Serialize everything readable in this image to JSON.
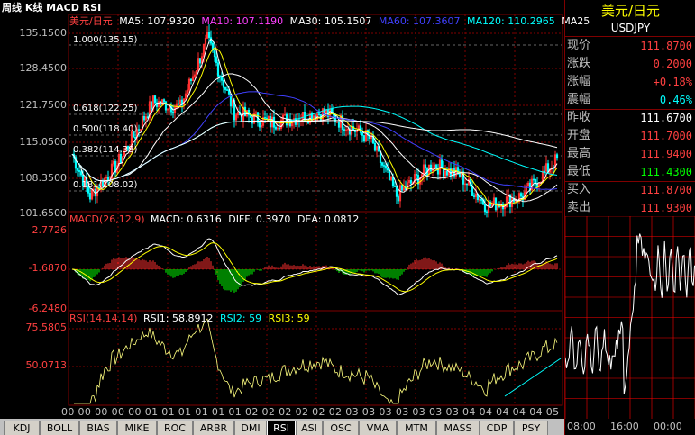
{
  "window_title": "周线 K线 MACD RSI",
  "main_legend": {
    "name": "美元/日元",
    "ma5": "MA5: 107.9320",
    "ma10": "MA10: 107.1190",
    "ma30": "MA30: 105.1507",
    "ma60": "MA60: 107.3607",
    "ma120": "MA120: 110.2965",
    "ma250": "MA25"
  },
  "fib_labels": [
    "1.000(135.15)",
    "0.618(122.25)",
    "0.500(118.40)",
    "0.382(114.38)",
    "0.181(108.02)"
  ],
  "price_axis": [
    "135.1500",
    "128.4500",
    "121.7500",
    "115.0500",
    "108.3500",
    "101.6500"
  ],
  "macd_legend": {
    "name": "MACD(26,12,9)",
    "macd": "MACD: 0.6316",
    "diff": "DIFF: 0.3970",
    "dea": "DEA: 0.0812"
  },
  "macd_axis": [
    "2.7726",
    "-1.6870",
    "-6.2480"
  ],
  "rsi_legend": {
    "name": "RSI(14,14,14)",
    "rsi1": "RSI1: 58.8912",
    "rsi2": "RSI2: 59",
    "rsi3": "RSI3: 59"
  },
  "rsi_axis": [
    "75.5805",
    "50.0713"
  ],
  "time_axis": "00 00 00 00 00 01 01 01 01 01 01 02 02 02 02 02 02 03 03 03 03 03 03 03 04 04 04 04 04 05 05 05 05 05",
  "tabs": [
    "KDJ",
    "BOLL",
    "BIAS",
    "MIKE",
    "ROC",
    "ARBR",
    "DMI",
    "RSI",
    "ASI",
    "OSC",
    "VMA",
    "MTM",
    "MASS",
    "CDP",
    "PSY"
  ],
  "active_tab": "RSI",
  "quote": {
    "title": "美元/日元",
    "symbol": "USDJPY",
    "rows": [
      {
        "label": "现价",
        "value": "111.8700",
        "color": "#ff4040"
      },
      {
        "label": "涨跌",
        "value": "0.2000",
        "color": "#ff4040"
      },
      {
        "label": "涨幅",
        "value": "+0.18%",
        "color": "#ff4040"
      },
      {
        "label": "震幅",
        "value": "0.46%",
        "color": "#00ffff"
      },
      {
        "label": "昨收",
        "value": "111.6700",
        "color": "#ffffff"
      },
      {
        "label": "开盘",
        "value": "111.7000",
        "color": "#ff4040"
      },
      {
        "label": "最高",
        "value": "111.9400",
        "color": "#ff4040"
      },
      {
        "label": "最低",
        "value": "111.4300",
        "color": "#00ff00"
      },
      {
        "label": "买入",
        "value": "111.8700",
        "color": "#ff4040"
      },
      {
        "label": "卖出",
        "value": "111.9300",
        "color": "#ff4040"
      }
    ]
  },
  "mini_time_axis": [
    "08:00",
    "16:00",
    "00:00"
  ],
  "colors": {
    "up": "#ff3030",
    "down": "#00ffff",
    "grid": "#800000",
    "ma5": "#ffffff",
    "ma10": "#ffff00",
    "ma30": "#ff00ff",
    "ma60": "#00ff00",
    "ma120": "#4040ff",
    "ma250": "#ffffff"
  }
}
